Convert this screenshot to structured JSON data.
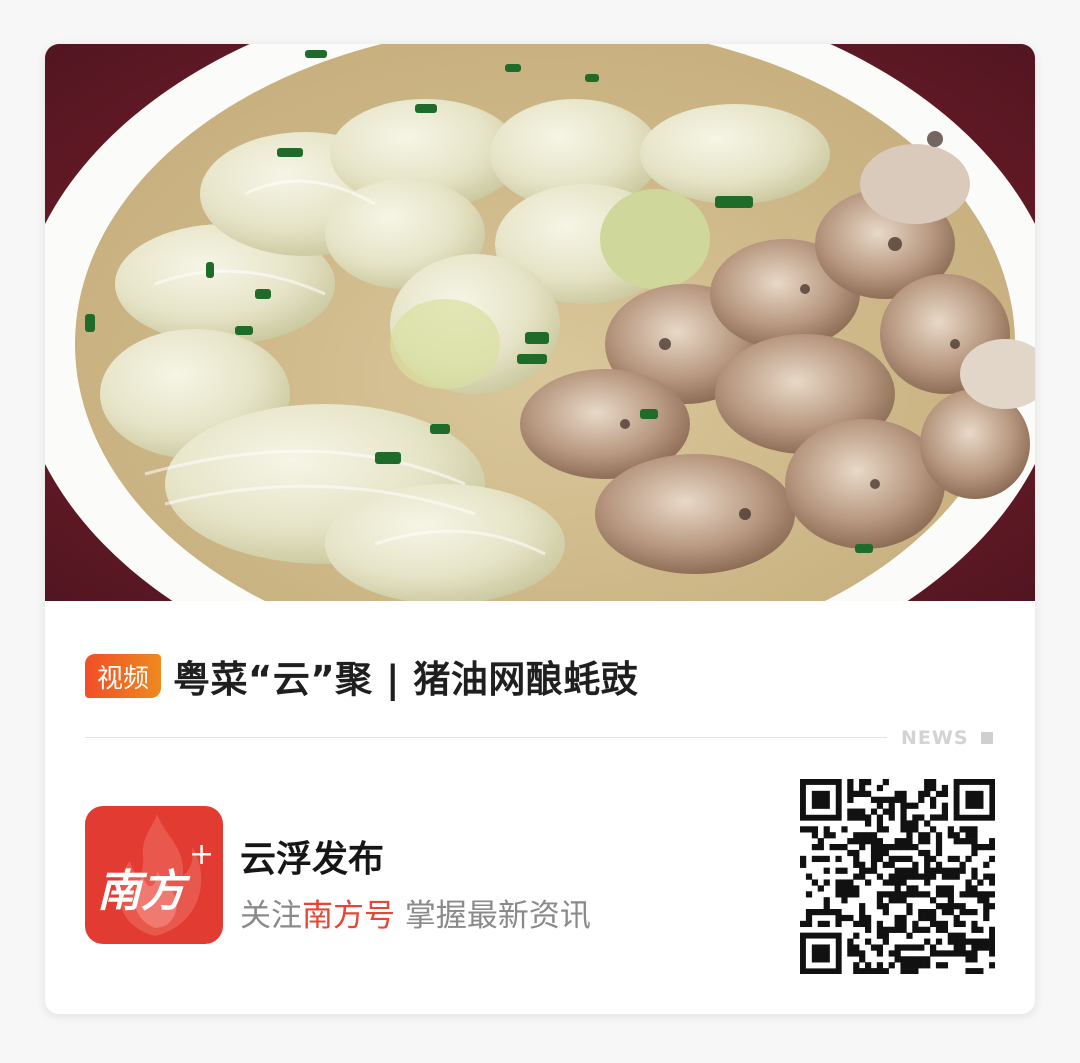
{
  "article": {
    "badge": "视频",
    "title": "粤菜“云”聚 | 猪油网酿蚝豉",
    "section_tag": "NEWS"
  },
  "account": {
    "name": "云浮发布",
    "slogan_prefix": "关注",
    "slogan_highlight": "南方号",
    "slogan_suffix": " 掌握最新资讯",
    "logo_text": "南方",
    "logo_plus": "+"
  },
  "colors": {
    "badge_start": "#f04e28",
    "badge_end": "#ee8a1f",
    "highlight": "#e44736",
    "logo_bg": "#e23b32"
  },
  "icons": [
    "dish-photo",
    "nanfang-plus-logo",
    "qr-code-icon"
  ]
}
